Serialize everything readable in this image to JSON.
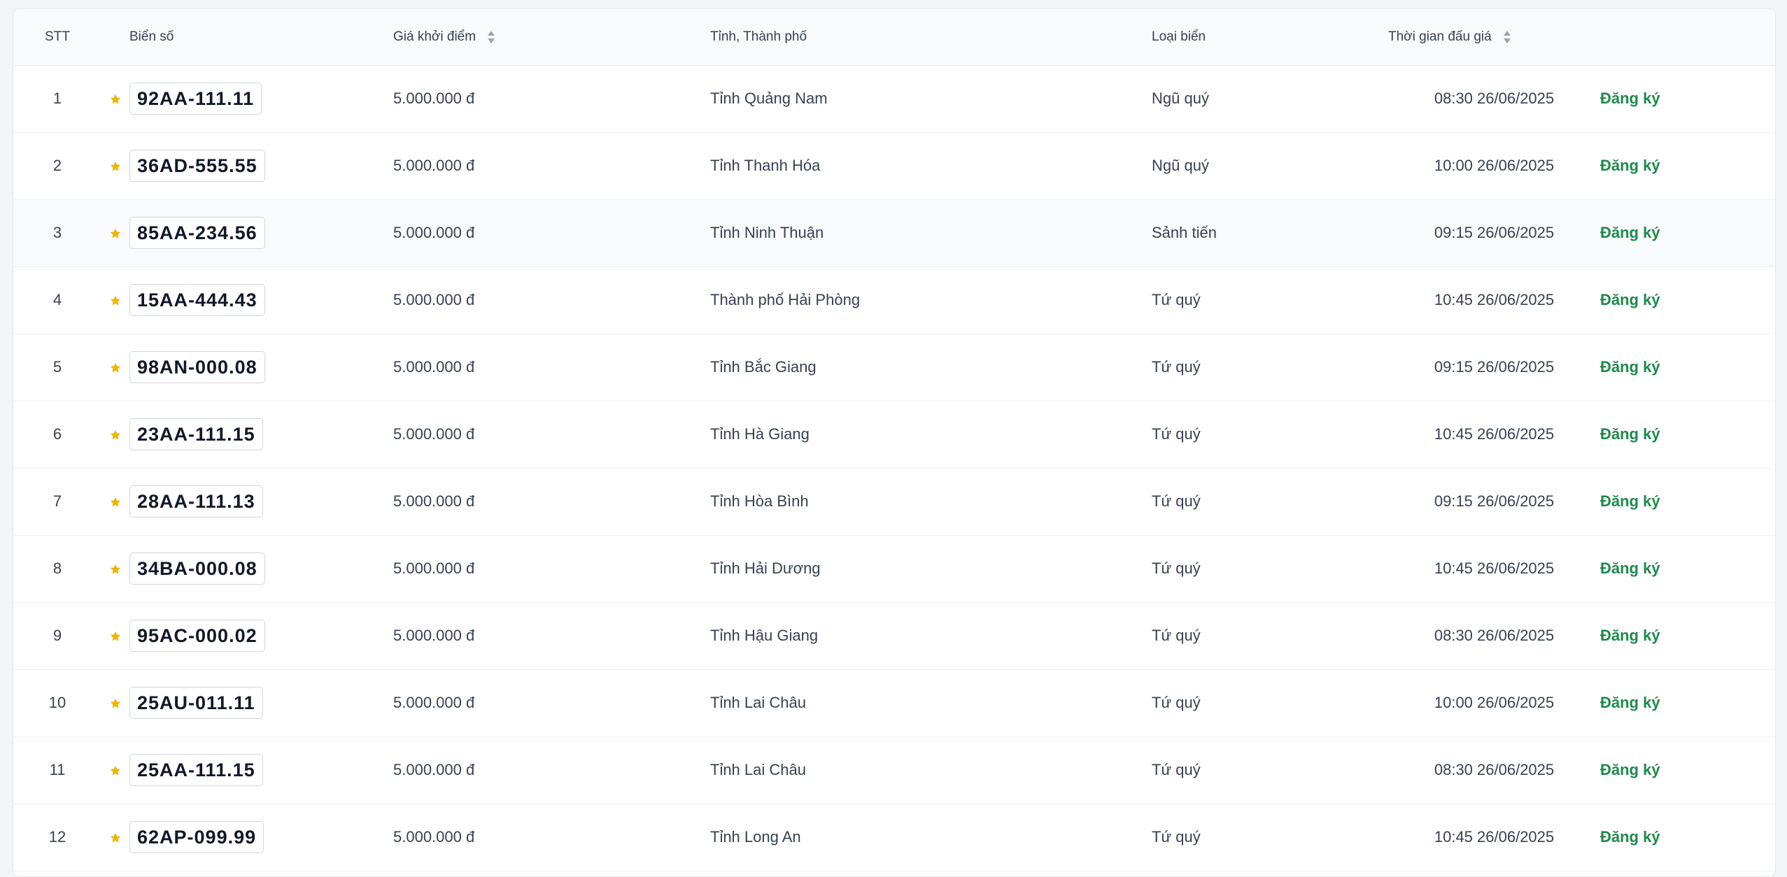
{
  "table": {
    "headers": {
      "stt": "STT",
      "plate": "Biển số",
      "price": "Giá khởi điểm",
      "province": "Tỉnh, Thành phố",
      "type": "Loại biển",
      "time": "Thời gian đấu giá"
    },
    "action_label": "Đăng ký",
    "colors": {
      "accent_green": "#1e8a4c",
      "star": "#f0b400"
    },
    "rows": [
      {
        "stt": "1",
        "plate": "92AA-111.11",
        "price": "5.000.000 đ",
        "province": "Tỉnh Quảng Nam",
        "type": "Ngũ quý",
        "time": "08:30 26/06/2025"
      },
      {
        "stt": "2",
        "plate": "36AD-555.55",
        "price": "5.000.000 đ",
        "province": "Tỉnh Thanh Hóa",
        "type": "Ngũ quý",
        "time": "10:00 26/06/2025"
      },
      {
        "stt": "3",
        "plate": "85AA-234.56",
        "price": "5.000.000 đ",
        "province": "Tỉnh Ninh Thuận",
        "type": "Sảnh tiến",
        "time": "09:15 26/06/2025"
      },
      {
        "stt": "4",
        "plate": "15AA-444.43",
        "price": "5.000.000 đ",
        "province": "Thành phố Hải Phòng",
        "type": "Tứ quý",
        "time": "10:45 26/06/2025"
      },
      {
        "stt": "5",
        "plate": "98AN-000.08",
        "price": "5.000.000 đ",
        "province": "Tỉnh Bắc Giang",
        "type": "Tứ quý",
        "time": "09:15 26/06/2025"
      },
      {
        "stt": "6",
        "plate": "23AA-111.15",
        "price": "5.000.000 đ",
        "province": "Tỉnh Hà Giang",
        "type": "Tứ quý",
        "time": "10:45 26/06/2025"
      },
      {
        "stt": "7",
        "plate": "28AA-111.13",
        "price": "5.000.000 đ",
        "province": "Tỉnh Hòa Bình",
        "type": "Tứ quý",
        "time": "09:15 26/06/2025"
      },
      {
        "stt": "8",
        "plate": "34BA-000.08",
        "price": "5.000.000 đ",
        "province": "Tỉnh Hải Dương",
        "type": "Tứ quý",
        "time": "10:45 26/06/2025"
      },
      {
        "stt": "9",
        "plate": "95AC-000.02",
        "price": "5.000.000 đ",
        "province": "Tỉnh Hậu Giang",
        "type": "Tứ quý",
        "time": "08:30 26/06/2025"
      },
      {
        "stt": "10",
        "plate": "25AU-011.11",
        "price": "5.000.000 đ",
        "province": "Tỉnh Lai Châu",
        "type": "Tứ quý",
        "time": "10:00 26/06/2025"
      },
      {
        "stt": "11",
        "plate": "25AA-111.15",
        "price": "5.000.000 đ",
        "province": "Tỉnh Lai Châu",
        "type": "Tứ quý",
        "time": "08:30 26/06/2025"
      },
      {
        "stt": "12",
        "plate": "62AP-099.99",
        "price": "5.000.000 đ",
        "province": "Tỉnh Long An",
        "type": "Tứ quý",
        "time": "10:45 26/06/2025"
      }
    ]
  }
}
